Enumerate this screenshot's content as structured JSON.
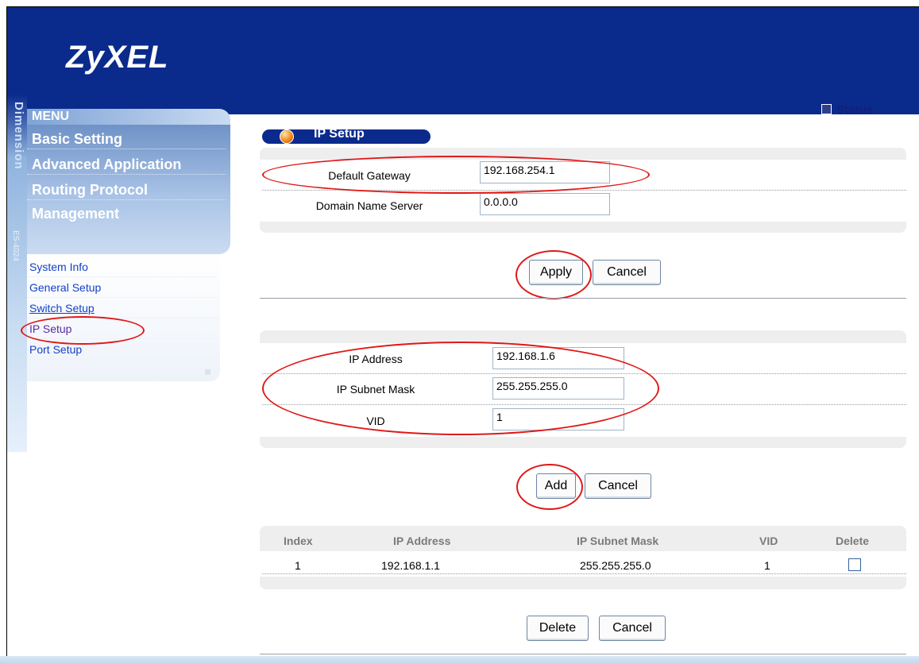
{
  "header": {
    "logo": "ZyXEL",
    "status_label": "Status"
  },
  "sidebar_brand": {
    "vertical_text": "Dimension",
    "model": "ES-4024"
  },
  "menu": {
    "title": "MENU",
    "items": [
      "Basic Setting",
      "Advanced Application",
      "Routing Protocol",
      "Management"
    ]
  },
  "submenu": {
    "items": [
      "System Info",
      "General Setup",
      "Switch Setup",
      "IP Setup",
      "Port Setup"
    ],
    "active": "IP Setup"
  },
  "page": {
    "title": "IP Setup"
  },
  "gateway_form": {
    "default_gateway_label": "Default Gateway",
    "default_gateway_value": "192.168.254.1",
    "dns_label": "Domain Name Server",
    "dns_value": "0.0.0.0",
    "apply_label": "Apply",
    "cancel_label": "Cancel"
  },
  "ip_form": {
    "ip_label": "IP Address",
    "ip_value": "192.168.1.6",
    "mask_label": "IP Subnet Mask",
    "mask_value": "255.255.255.0",
    "vid_label": "VID",
    "vid_value": "1",
    "add_label": "Add",
    "cancel_label": "Cancel"
  },
  "ip_table": {
    "columns": [
      "Index",
      "IP Address",
      "IP Subnet Mask",
      "VID",
      "Delete"
    ],
    "rows": [
      {
        "index": "1",
        "ip": "192.168.1.1",
        "mask": "255.255.255.0",
        "vid": "1",
        "delete_checked": false
      }
    ]
  },
  "table_actions": {
    "delete_label": "Delete",
    "cancel_label": "Cancel"
  },
  "colors": {
    "header_blue": "#0a2a8c",
    "annotation_red": "#e01818",
    "link_blue": "#1340c8"
  }
}
